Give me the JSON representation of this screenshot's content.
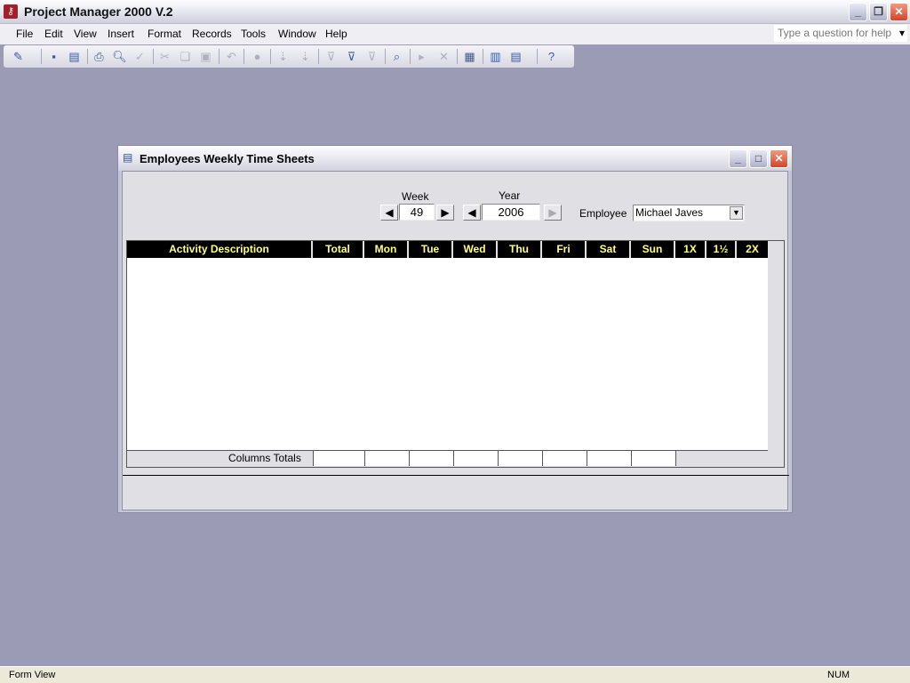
{
  "app": {
    "title": "Project Manager 2000 V.2",
    "icon": "access-key-icon"
  },
  "window_controls": {
    "minimize": "_",
    "restore": "❐",
    "close": "✕"
  },
  "menu": [
    "File",
    "Edit",
    "View",
    "Insert",
    "Format",
    "Records",
    "Tools",
    "Window",
    "Help"
  ],
  "help_box": {
    "placeholder": "Type a question for help",
    "arrow": "▾"
  },
  "toolbar": {
    "icons": [
      "design-view",
      "save",
      "print-preview-db",
      "print",
      "print-preview",
      "spelling",
      "cut",
      "copy",
      "paste",
      "undo",
      "insert-hyperlink",
      "sort-ascending",
      "sort-descending",
      "filter-by-selection",
      "filter-by-form",
      "apply-filter",
      "find",
      "new-record",
      "delete-record",
      "properties",
      "database-window",
      "new-object",
      "help"
    ]
  },
  "form": {
    "title": "Employees Weekly Time Sheets",
    "week": {
      "label": "Week",
      "value": "49"
    },
    "year": {
      "label": "Year",
      "value": "2006"
    },
    "employee": {
      "label": "Employee",
      "value": "Michael Javes"
    },
    "columns": [
      "Activity  Description",
      "Total",
      "Mon",
      "Tue",
      "Wed",
      "Thu",
      "Fri",
      "Sat",
      "Sun",
      "1X",
      "1½",
      "2X"
    ],
    "totals_label": "Columns Totals"
  },
  "status": {
    "left": "Form View",
    "num": "NUM"
  }
}
